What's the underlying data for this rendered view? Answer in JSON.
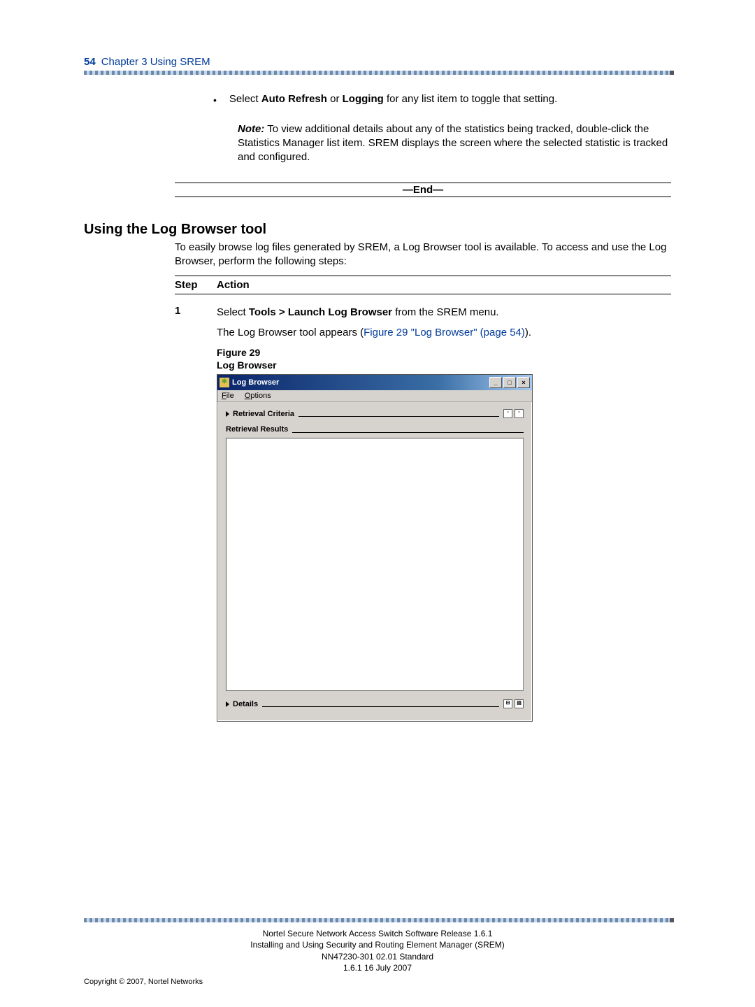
{
  "header": {
    "page_number": "54",
    "chapter": "Chapter 3  Using SREM"
  },
  "bullet": {
    "pre": "Select ",
    "b1": "Auto Refresh",
    "mid": " or ",
    "b2": "Logging",
    "post": " for any list item to toggle that setting."
  },
  "note": {
    "label": "Note:",
    "text": "  To view additional details about any of the statistics being tracked, double-click the Statistics Manager list item.  SREM displays the screen where the selected statistic is tracked and configured."
  },
  "end_marker": "—End—",
  "h2": "Using the Log Browser tool",
  "intro": "To easily browse log files generated by SREM, a Log Browser tool is available. To access and use the Log Browser, perform the following steps:",
  "table_head": {
    "step": "Step",
    "action": "Action"
  },
  "step1": {
    "num": "1",
    "pre": "Select ",
    "bold": "Tools > Launch Log Browser",
    "post": " from the SREM menu.",
    "line2_pre": "The Log Browser tool appears (",
    "link": "Figure 29 \"Log Browser\" (page 54)",
    "line2_post": ")."
  },
  "figure": {
    "num": "Figure 29",
    "title": "Log Browser"
  },
  "window": {
    "title": "Log Browser",
    "minimize": "_",
    "maximize": "□",
    "close": "×",
    "menu_file": "File",
    "menu_options": "Options",
    "section_criteria": "Retrieval Criteria",
    "section_results": "Retrieval Results",
    "section_details": "Details"
  },
  "footer": {
    "line1": "Nortel Secure Network Access Switch Software Release 1.6.1",
    "line2": "Installing and Using Security and Routing Element Manager (SREM)",
    "line3": "NN47230-301   02.01   Standard",
    "line4": "1.6.1   16 July 2007",
    "copyright": "Copyright © 2007, Nortel Networks"
  }
}
